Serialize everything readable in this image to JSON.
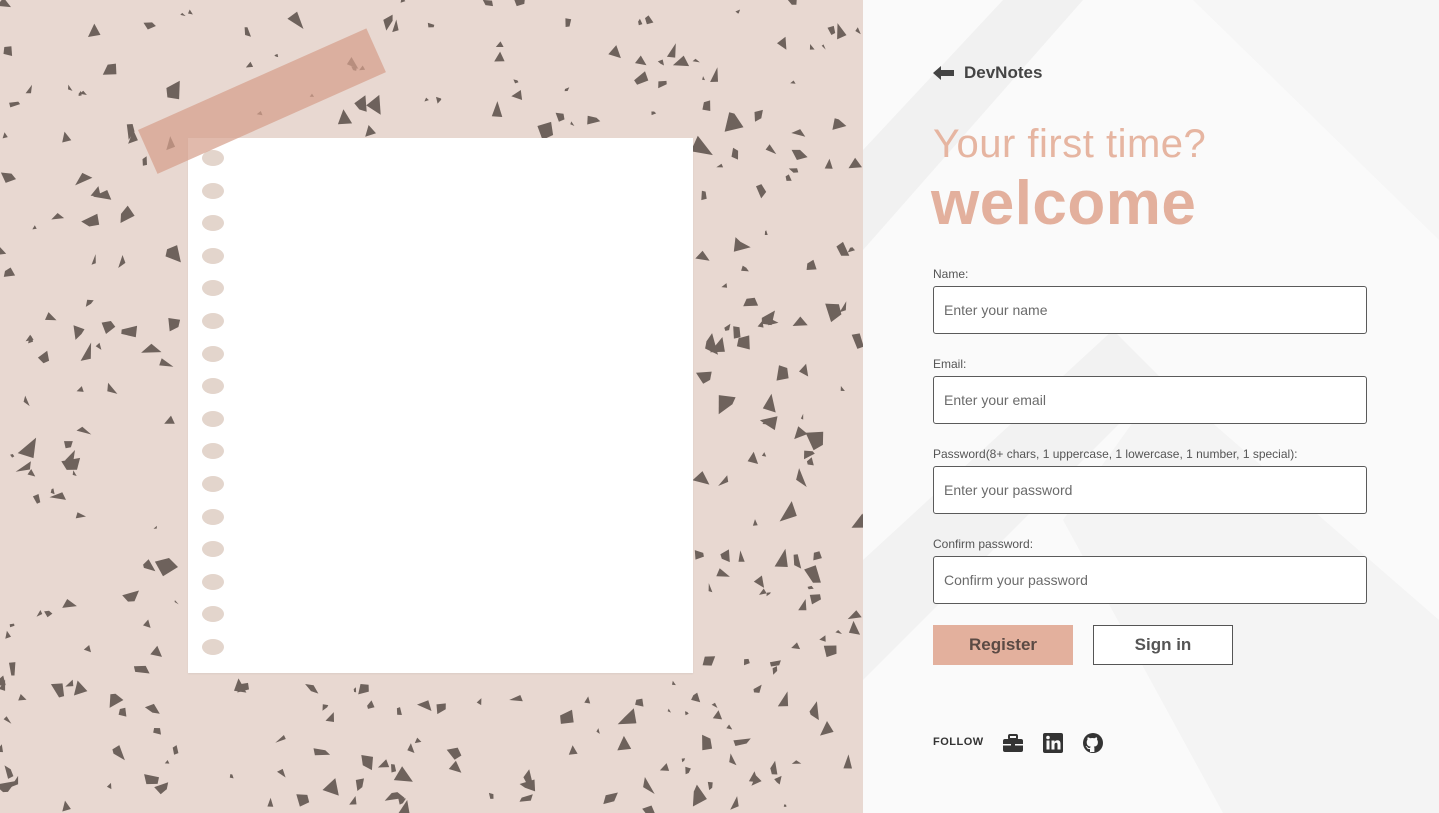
{
  "brand": {
    "name": "DevNotes",
    "back_icon": "arrow-left-icon"
  },
  "heading": {
    "subtitle": "Your first time?",
    "title": "welcome"
  },
  "form": {
    "name": {
      "label": "Name:",
      "placeholder": "Enter your name",
      "value": ""
    },
    "email": {
      "label": "Email:",
      "placeholder": "Enter your email",
      "value": ""
    },
    "password": {
      "label": "Password(8+ chars, 1 uppercase, 1 lowercase, 1 number, 1 special):",
      "placeholder": "Enter your password",
      "value": ""
    },
    "confirm": {
      "label": "Confirm password:",
      "placeholder": "Confirm your password",
      "value": ""
    }
  },
  "buttons": {
    "register": "Register",
    "signin": "Sign in"
  },
  "follow": {
    "label": "FOLLOW",
    "icons": [
      "briefcase-icon",
      "linkedin-icon",
      "github-icon"
    ]
  },
  "colors": {
    "accent": "#e3b09d",
    "left_bg": "#e8d8d1",
    "confetti": "#6e625c",
    "tape": "#d6a08c"
  }
}
